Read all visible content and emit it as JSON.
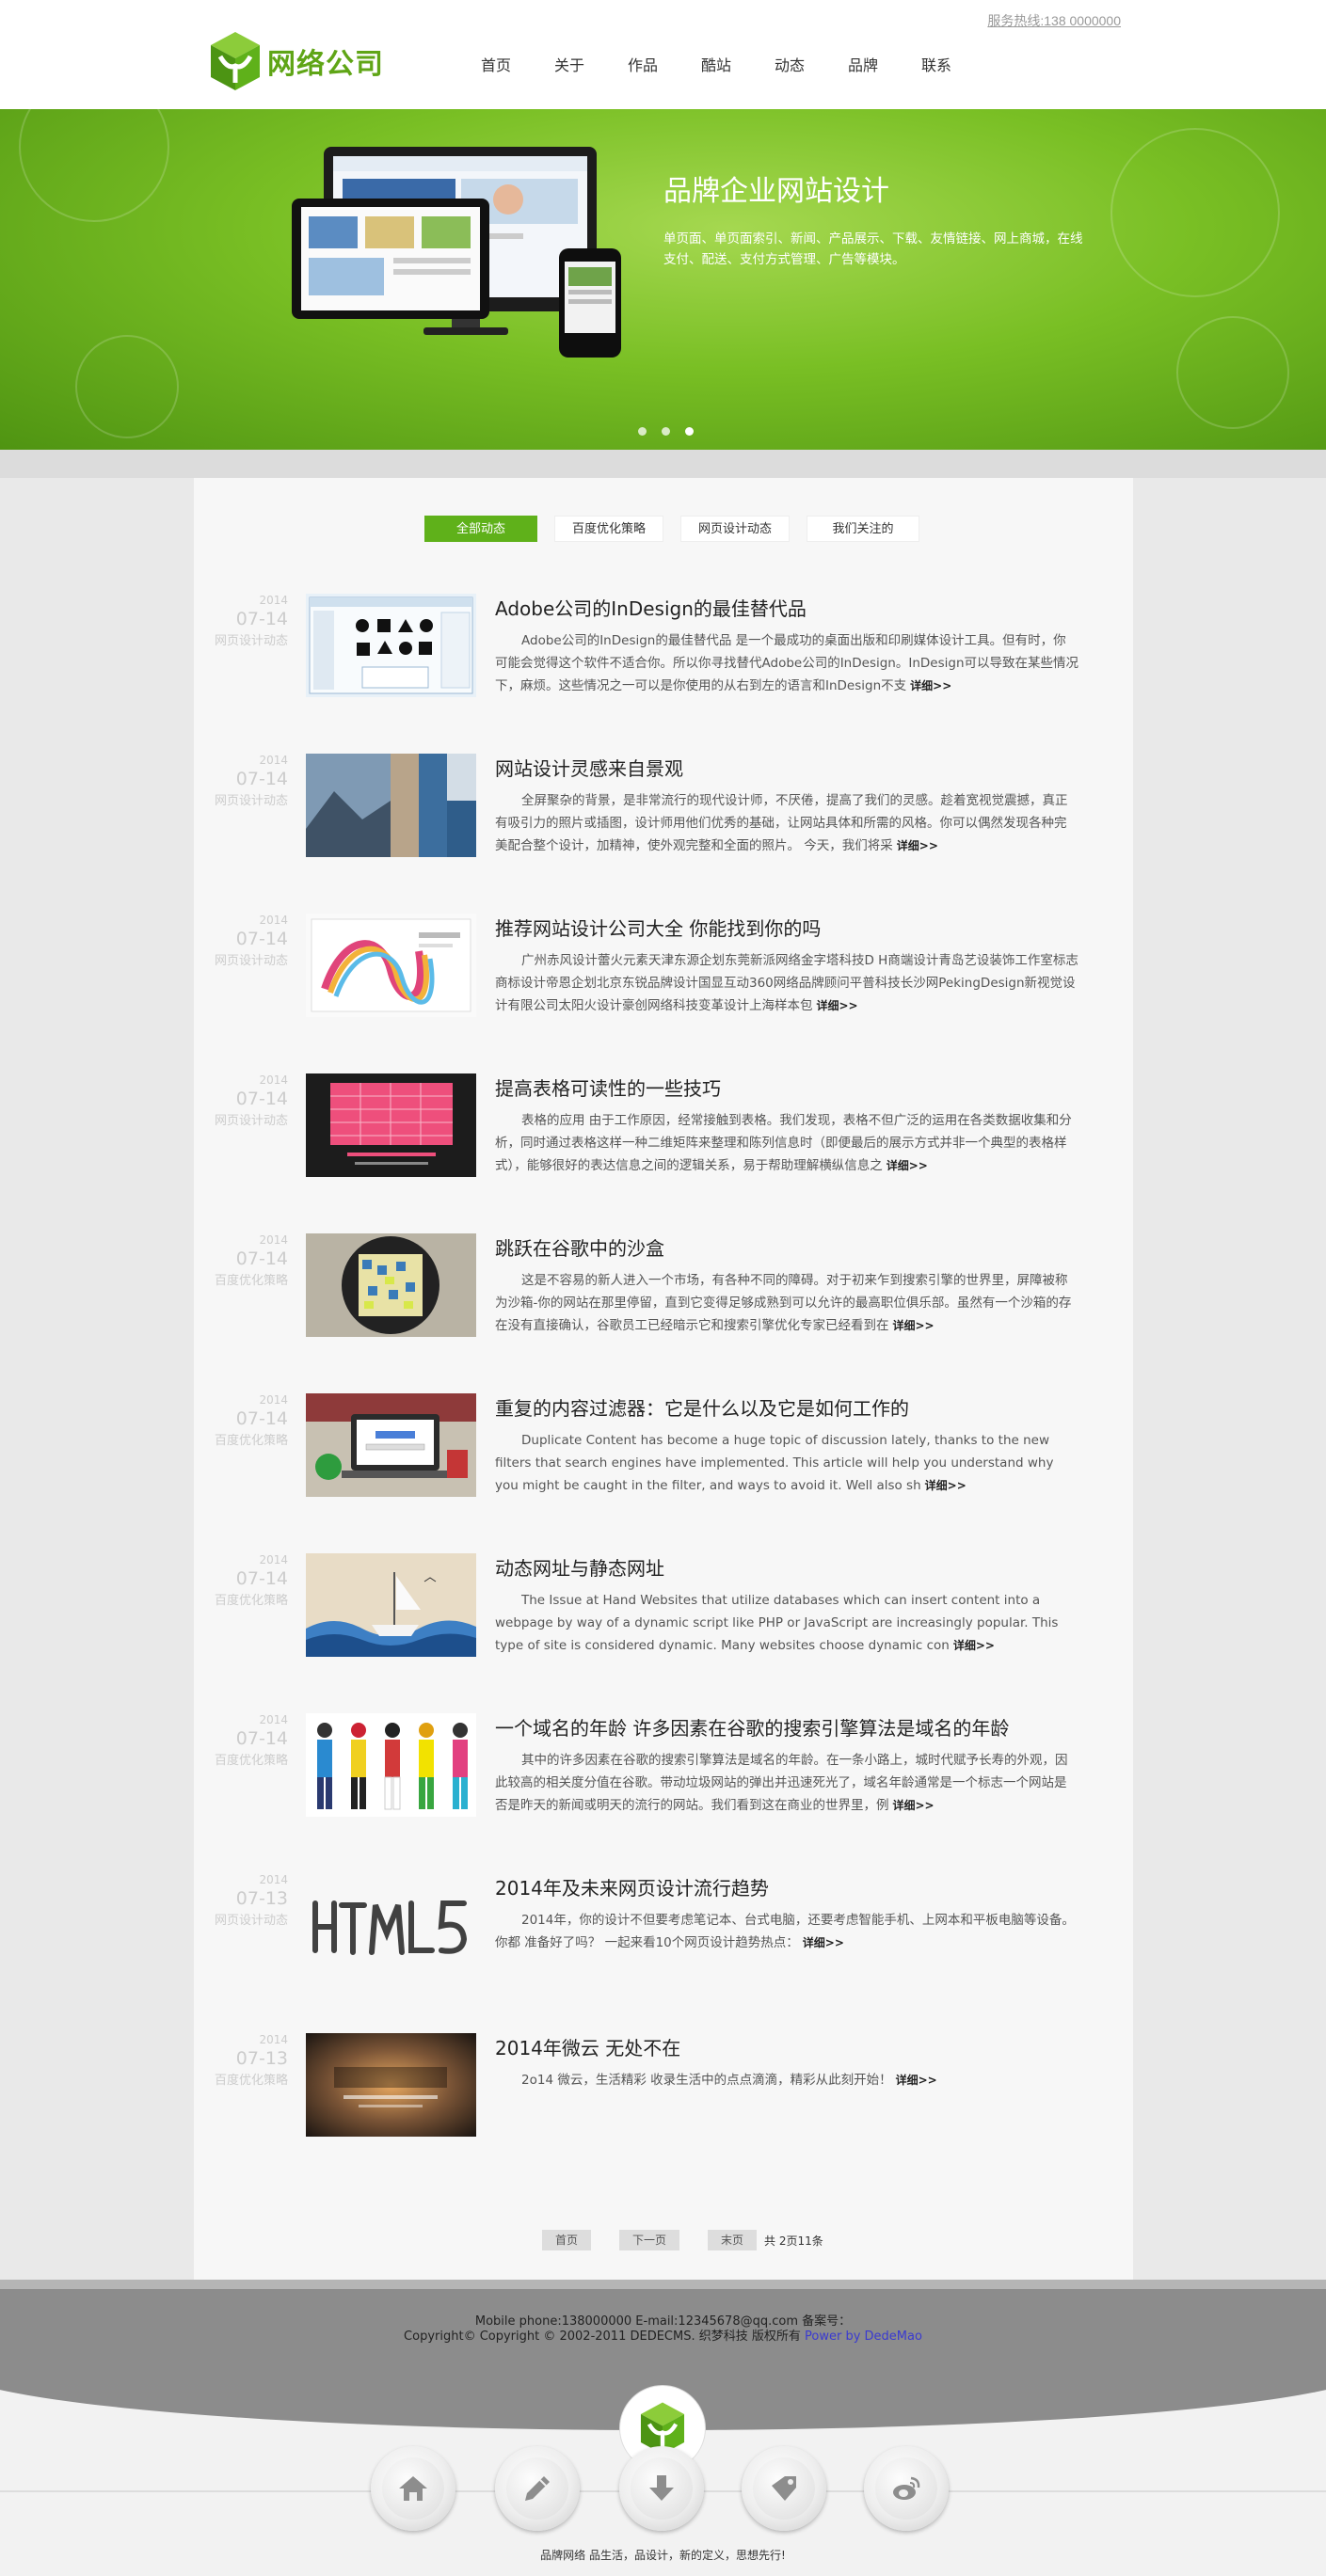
{
  "header": {
    "logo_text": "网络公司",
    "hotline": "服务热线:138 0000000",
    "nav": [
      "首页",
      "关于",
      "作品",
      "酷站",
      "动态",
      "品牌",
      "联系"
    ]
  },
  "banner": {
    "title": "品牌企业网站设计",
    "description": "单页面、单页面索引、新闻、产品展示、下载、友情链接、网上商城，在线支付、配送、支付方式管理、广告等模块。",
    "slide_count": 3,
    "active_slide": 3
  },
  "tabs": [
    "全部动态",
    "百度优化策略",
    "网页设计动态",
    "我们关注的"
  ],
  "articles": [
    {
      "year": "2014",
      "date": "07-14",
      "category": "网页设计动态",
      "title": "Adobe公司的InDesign的最佳替代品",
      "body": "Adobe公司的InDesign的最佳替代品 是一个最成功的桌面出版和印刷媒体设计工具。但有时，你可能会觉得这个软件不适合你。所以你寻找替代Adobe公司的InDesign。InDesign可以导致在某些情况下，麻烦。这些情况之一可以是你使用的从右到左的语言和InDesign不支",
      "more": "详细>>"
    },
    {
      "year": "2014",
      "date": "07-14",
      "category": "网页设计动态",
      "title": "网站设计灵感来自景观",
      "body": "全屏聚杂的背景，是非常流行的现代设计师，不厌倦，提高了我们的灵感。趁着宽视觉震撼，真正有吸引力的照片或插图，设计师用他们优秀的基础，让网站具体和所需的风格。你可以偶然发现各种完美配合整个设计，加精神，使外观完整和全面的照片。 今天，我们将采",
      "more": "详细>>"
    },
    {
      "year": "2014",
      "date": "07-14",
      "category": "网页设计动态",
      "title": "推荐网站设计公司大全 你能找到你的吗",
      "body": "广州赤风设计蕾火元素天津东源企划东莞新派网络金字塔科技D H商端设计青岛艺设装饰工作室标志商标设计帝恩企划北京东锐品牌设计国显互动360网络品牌顾问平普科技长沙网PekingDesign新视觉设计有限公司太阳火设计豪创网络科技变革设计上海样本包",
      "more": "详细>>"
    },
    {
      "year": "2014",
      "date": "07-14",
      "category": "网页设计动态",
      "title": "提高表格可读性的一些技巧",
      "body": "表格的应用 由于工作原因，经常接触到表格。我们发现，表格不但广泛的运用在各类数据收集和分析，同时通过表格这样一种二维矩阵来整理和陈列信息时（即便最后的展示方式并非一个典型的表格样式），能够很好的表达信息之间的逻辑关系，易于帮助理解横纵信息之",
      "more": "详细>>"
    },
    {
      "year": "2014",
      "date": "07-14",
      "category": "百度优化策略",
      "title": "跳跃在谷歌中的沙盒",
      "body": "这是不容易的新人进入一个市场，有各种不同的障碍。对于初来乍到搜索引擎的世界里，屏障被称为沙箱-你的网站在那里停留，直到它变得足够成熟到可以允许的最高职位俱乐部。虽然有一个沙箱的存在没有直接确认，谷歌员工已经暗示它和搜索引擎优化专家已经看到在",
      "more": "详细>>"
    },
    {
      "year": "2014",
      "date": "07-14",
      "category": "百度优化策略",
      "title": "重复的内容过滤器：它是什么以及它是如何工作的",
      "body": "Duplicate Content has become a huge topic of discussion lately, thanks to the new filters that search engines have implemented. This article will help you understand why you might be caught in the filter, and ways to avoid it. Well also sh",
      "more": "详细>>"
    },
    {
      "year": "2014",
      "date": "07-14",
      "category": "百度优化策略",
      "title": "动态网址与静态网址",
      "body": "The Issue at Hand Websites that utilize databases which can insert content into a webpage by way of a dynamic script like PHP or JavaScript are increasingly popular. This type of site is considered dynamic. Many websites choose dynamic con",
      "more": "详细>>"
    },
    {
      "year": "2014",
      "date": "07-14",
      "category": "百度优化策略",
      "title": "一个域名的年龄 许多因素在谷歌的搜索引擎算法是域名的年龄",
      "body": "其中的许多因素在谷歌的搜索引擎算法是域名的年龄。在一条小路上，城时代赋予长寿的外观，因此较高的相关度分值在谷歌。带动垃圾网站的弹出并迅速死光了，域名年龄通常是一个标志一个网站是否是昨天的新闻或明天的流行的网站。我们看到这在商业的世界里，例",
      "more": "详细>>"
    },
    {
      "year": "2014",
      "date": "07-13",
      "category": "网页设计动态",
      "title": "2014年及未来网页设计流行趋势",
      "body": "2014年，你的设计不但要考虑笔记本、台式电脑，还要考虑智能手机、上网本和平板电脑等设备。你都 准备好了吗？ 一起来看10个网页设计趋势热点：",
      "more": "详细>>"
    },
    {
      "year": "2014",
      "date": "07-13",
      "category": "百度优化策略",
      "title": "2014年微云 无处不在",
      "body": "2o14 微云，生活精彩 收录生活中的点点滴滴，精彩从此刻开始！",
      "more": "详细>>"
    }
  ],
  "pager": {
    "first": "首页",
    "next": "下一页",
    "last": "末页",
    "summary": "共 2页11条"
  },
  "footer": {
    "line1": "Mobile phone:138000000  E-mail:12345678@qq.com  备案号：",
    "line2_prefix": "Copyright© Copyright © 2002-2011 DEDECMS. 织梦科技 版权所有 ",
    "line2_link": "Power by DedeMao",
    "buttons": [
      "home-icon",
      "pencil-icon",
      "download-icon",
      "tag-icon",
      "weibo-icon"
    ],
    "slogan": "品牌网络 品生活，品设计，新的定义，思想先行!"
  },
  "colors": {
    "brand_green": "#5fb11a",
    "banner_green": "#79bf24",
    "footer_grey": "#8c8c8c"
  }
}
